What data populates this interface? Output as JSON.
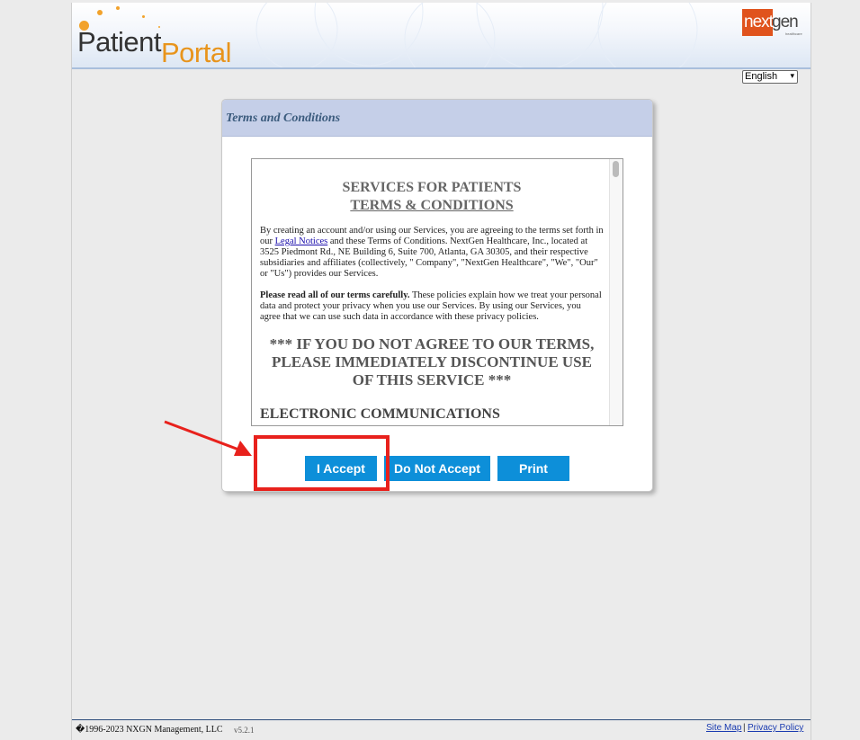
{
  "header": {
    "logo_part1": "Patient",
    "logo_part2": "Portal",
    "brand_main_left": "next",
    "brand_main_right": "gen",
    "brand_sub": "healthcare",
    "language": "English"
  },
  "dialog": {
    "title": "Terms and Conditions",
    "terms": {
      "heading1": "SERVICES FOR PATIENTS",
      "heading2": "TERMS & CONDITIONS",
      "p1_before": "By creating an account and/or using our Services, you are agreeing to the terms set forth in our ",
      "p1_link": "Legal Notices",
      "p1_after": " and these Terms of Conditions. NextGen Healthcare, Inc., located at 3525 Piedmont Rd., NE Building 6, Suite 700, Atlanta, GA 30305, and their respective subsidiaries and affiliates (collectively, \" Company\", \"NextGen Healthcare\", \"We\", \"Our\" or \"Us\") provides our Services.",
      "p2_bold": "Please read all of our terms carefully.",
      "p2_after": " These policies explain how we treat your personal data and protect your privacy when you use our Services. By using our Services, you agree that we can use such data in accordance with these privacy policies.",
      "warning": "*** IF YOU DO NOT AGREE TO OUR TERMS, PLEASE IMMEDIATELY DISCONTINUE USE OF THIS SERVICE ***",
      "section": "ELECTRONIC COMMUNICATIONS"
    },
    "buttons": {
      "accept": "I Accept",
      "decline": "Do Not Accept",
      "print": "Print"
    }
  },
  "footer": {
    "copyright": "�1996-2023 NXGN Management, LLC",
    "version": "v5.2.1",
    "site_map": "Site Map",
    "separator": "|",
    "privacy": "Privacy Policy"
  },
  "colors": {
    "button": "#0d8fd9",
    "annotation": "#e8211c",
    "dialog_header": "#c5cfe8"
  }
}
